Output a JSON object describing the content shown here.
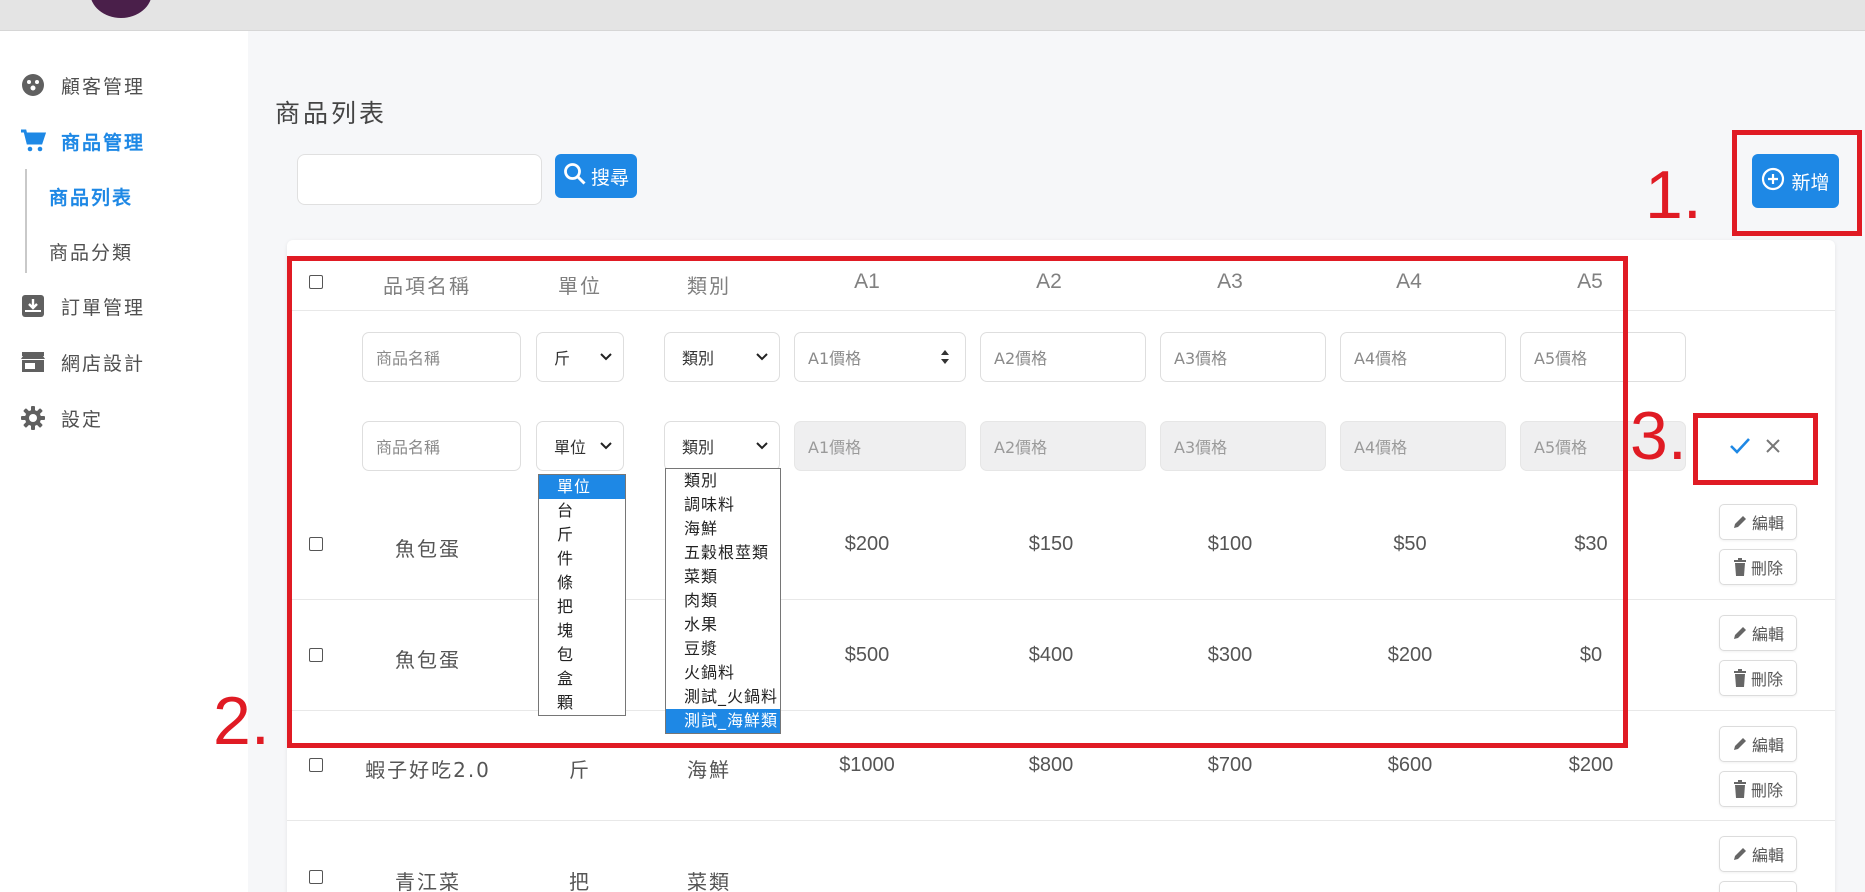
{
  "sidebar": {
    "items": [
      {
        "label": "顧客管理",
        "icon": "customer-icon"
      },
      {
        "label": "商品管理",
        "icon": "cart-icon"
      },
      {
        "label": "訂單管理",
        "icon": "order-icon"
      },
      {
        "label": "網店設計",
        "icon": "store-icon"
      },
      {
        "label": "設定",
        "icon": "gear-icon"
      }
    ],
    "sub_items": [
      {
        "label": "商品列表"
      },
      {
        "label": "商品分類"
      }
    ]
  },
  "page": {
    "title": "商品列表",
    "search_button": "搜尋",
    "add_button": "新增"
  },
  "table": {
    "headers": [
      "品項名稱",
      "單位",
      "類別",
      "A1",
      "A2",
      "A3",
      "A4",
      "A5"
    ],
    "filter_row": {
      "name_placeholder": "商品名稱",
      "unit_value": "斤",
      "category_value": "類別",
      "price_placeholders": [
        "A1價格",
        "A2價格",
        "A3價格",
        "A4價格",
        "A5價格"
      ]
    },
    "new_row": {
      "name_placeholder": "商品名稱",
      "unit_value": "單位",
      "category_value": "類別",
      "price_placeholders": [
        "A1價格",
        "A2價格",
        "A3價格",
        "A4價格",
        "A5價格"
      ]
    },
    "rows": [
      {
        "name": "魚包蛋",
        "unit": "",
        "category": "",
        "prices": [
          "$200",
          "$150",
          "$100",
          "$50",
          "$30"
        ]
      },
      {
        "name": "魚包蛋",
        "unit": "",
        "category": "",
        "prices": [
          "$500",
          "$400",
          "$300",
          "$200",
          "$0"
        ]
      },
      {
        "name": "蝦子好吃2.0",
        "unit": "斤",
        "category": "海鮮",
        "prices": [
          "$1000",
          "$800",
          "$700",
          "$600",
          "$200"
        ]
      },
      {
        "name": "青江菜",
        "unit": "把",
        "category": "菜類",
        "prices": [
          "",
          "",
          "",
          "",
          ""
        ]
      }
    ],
    "row_actions": {
      "edit": "編輯",
      "delete": "刪除"
    }
  },
  "unit_dropdown": {
    "options": [
      "單位",
      "台",
      "斤",
      "件",
      "條",
      "把",
      "塊",
      "包",
      "盒",
      "顆"
    ],
    "highlighted": "單位"
  },
  "category_dropdown": {
    "options": [
      "類別",
      "調味料",
      "海鮮",
      "五穀根莖類",
      "菜類",
      "肉類",
      "水果",
      "豆漿",
      "火鍋料",
      "測試_火鍋料",
      "測試_海鮮類"
    ],
    "highlighted": "測試_海鮮類"
  },
  "annotations": [
    "1.",
    "2.",
    "3."
  ],
  "colors": {
    "accent": "#1e88e5",
    "annotation_red": "#e01b24",
    "sidebar_bg": "#ffffff",
    "page_bg": "#f6f7f9"
  }
}
